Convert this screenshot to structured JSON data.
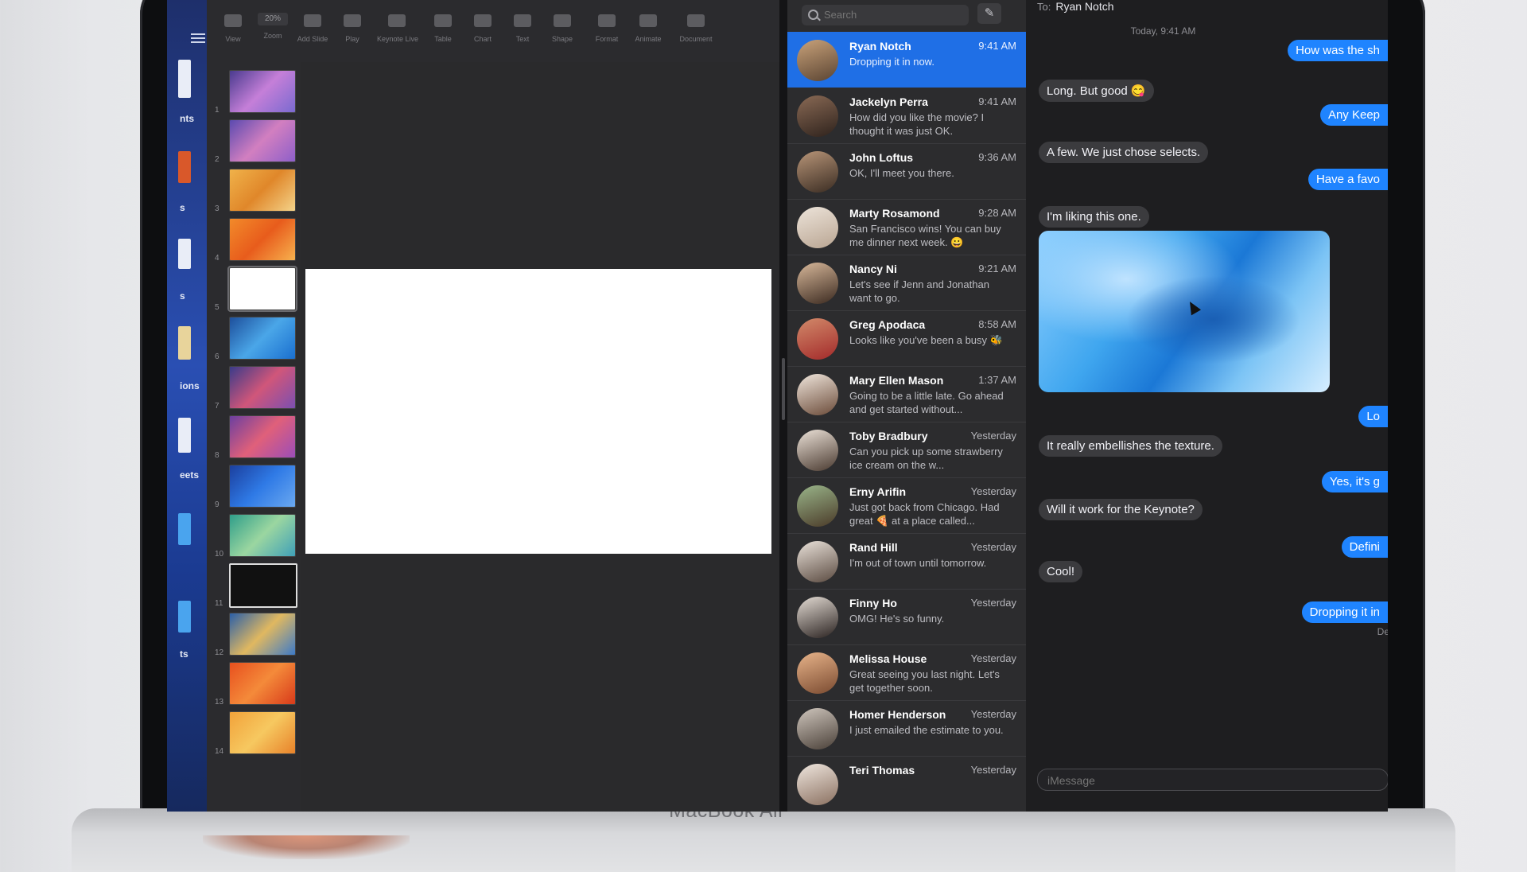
{
  "device": {
    "brand_label": "MacBook Air"
  },
  "keynote": {
    "toolbar": [
      {
        "label": "View",
        "icon": "view-icon"
      },
      {
        "label": "Zoom",
        "icon": "zoom-icon"
      },
      {
        "label": "Add Slide",
        "icon": "add-slide-icon"
      },
      {
        "label": "Play",
        "icon": "play-icon"
      },
      {
        "label": "Keynote Live",
        "icon": "keynote-live-icon"
      },
      {
        "label": "Table",
        "icon": "table-icon"
      },
      {
        "label": "Chart",
        "icon": "chart-icon"
      },
      {
        "label": "Text",
        "icon": "text-icon"
      },
      {
        "label": "Shape",
        "icon": "shape-icon"
      },
      {
        "label": "Format",
        "icon": "format-icon"
      },
      {
        "label": "Animate",
        "icon": "animate-icon"
      },
      {
        "label": "Document",
        "icon": "document-icon"
      }
    ],
    "zoom_value": "20%",
    "slide_numbers": [
      "1",
      "2",
      "3",
      "4",
      "5",
      "6",
      "7",
      "8",
      "9",
      "10",
      "11",
      "12",
      "13",
      "14"
    ],
    "sidebar_labels": [
      "nts",
      "s",
      "s",
      "ions",
      "eets",
      "ts"
    ]
  },
  "messages": {
    "search_placeholder": "Search",
    "compose_icon": "compose-icon",
    "conversations": [
      {
        "name": "Ryan Notch",
        "time": "9:41 AM",
        "preview": "Dropping it in now.",
        "active": true
      },
      {
        "name": "Jackelyn Perra",
        "time": "9:41 AM",
        "preview": "How did you like the movie? I thought it was just OK."
      },
      {
        "name": "John Loftus",
        "time": "9:36 AM",
        "preview": "OK, I'll meet you there."
      },
      {
        "name": "Marty Rosamond",
        "time": "9:28 AM",
        "preview": "San Francisco wins! You can buy me dinner next week. 😀"
      },
      {
        "name": "Nancy Ni",
        "time": "9:21 AM",
        "preview": "Let's see if Jenn and Jonathan want to go."
      },
      {
        "name": "Greg Apodaca",
        "time": "8:58 AM",
        "preview": "Looks like you've been a busy 🐝"
      },
      {
        "name": "Mary Ellen Mason",
        "time": "1:37 AM",
        "preview": "Going to be a little late. Go ahead and get started without..."
      },
      {
        "name": "Toby Bradbury",
        "time": "Yesterday",
        "preview": "Can you pick up some strawberry ice cream on the w..."
      },
      {
        "name": "Erny Arifin",
        "time": "Yesterday",
        "preview": "Just got back from Chicago. Had great 🍕 at a place called..."
      },
      {
        "name": "Rand Hill",
        "time": "Yesterday",
        "preview": "I'm out of town until tomorrow."
      },
      {
        "name": "Finny Ho",
        "time": "Yesterday",
        "preview": "OMG! He's so funny."
      },
      {
        "name": "Melissa House",
        "time": "Yesterday",
        "preview": "Great seeing you last night. Let's get together soon."
      },
      {
        "name": "Homer Henderson",
        "time": "Yesterday",
        "preview": "I just emailed the estimate to you."
      },
      {
        "name": "Teri Thomas",
        "time": "Yesterday",
        "preview": ""
      }
    ]
  },
  "chat": {
    "to_label": "To:",
    "to_name": "Ryan Notch",
    "date_stamp": "Today, 9:41 AM",
    "bubbles": [
      {
        "dir": "out",
        "text": "How was the sh"
      },
      {
        "dir": "in",
        "text": "Long. But good 😋"
      },
      {
        "dir": "out",
        "text": "Any Keep"
      },
      {
        "dir": "in",
        "text": "A few. We just chose selects."
      },
      {
        "dir": "out",
        "text": "Have a favo"
      },
      {
        "dir": "in",
        "text": "I'm liking this one."
      },
      {
        "dir": "out",
        "text": "Lo"
      },
      {
        "dir": "in",
        "text": "It really embellishes the texture."
      },
      {
        "dir": "out",
        "text": "Yes, it's g"
      },
      {
        "dir": "in",
        "text": "Will it work for the Keynote?"
      },
      {
        "dir": "out",
        "text": "Defini"
      },
      {
        "dir": "in",
        "text": "Cool!"
      },
      {
        "dir": "out",
        "text": "Dropping it in"
      }
    ],
    "delivered": "De",
    "input_placeholder": "iMessage"
  }
}
